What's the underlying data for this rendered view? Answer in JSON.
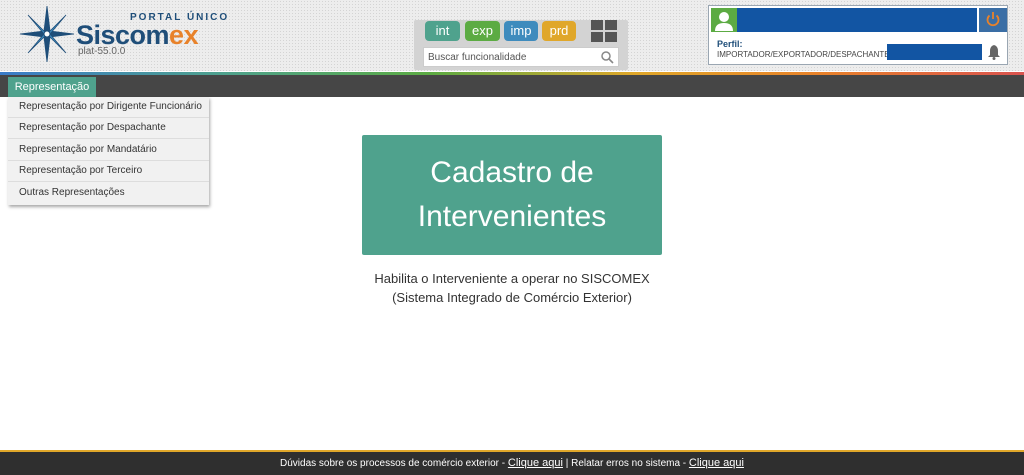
{
  "header": {
    "portal_label": "PORTAL ÚNICO",
    "brand_part1": "Siscom",
    "brand_part2": "ex",
    "version": "plat-55.0.0"
  },
  "modules": {
    "int": "int",
    "exp": "exp",
    "imp": "imp",
    "prd": "prd"
  },
  "search": {
    "placeholder": "Buscar funcionalidade"
  },
  "user": {
    "perfil_label": "Perfil:",
    "perfil_value": "IMPORTADOR/EXPORTADOR/DESPACHANTE"
  },
  "nav": {
    "active_tab": "Representação"
  },
  "dropdown": {
    "items": [
      "Representação por Dirigente Funcionário",
      "Representação por Despachante",
      "Representação por Mandatário",
      "Representação por Terceiro",
      "Outras Representações"
    ]
  },
  "main": {
    "tile_title": "Cadastro de Intervenientes",
    "description_line1": "Habilita o Interveniente a operar no SISCOMEX",
    "description_line2": "(Sistema Integrado de Comércio Exterior)"
  },
  "footer": {
    "text1": "Dúvidas sobre os processos de comércio exterior - ",
    "link1": "Clique aqui",
    "separator": " | Relatar erros no sistema - ",
    "link2": "Clique aqui"
  },
  "colors": {
    "accent_teal": "#4fa28d",
    "brand_blue": "#1f4e79",
    "brand_orange": "#e8822a",
    "nav_dark": "#464646"
  }
}
